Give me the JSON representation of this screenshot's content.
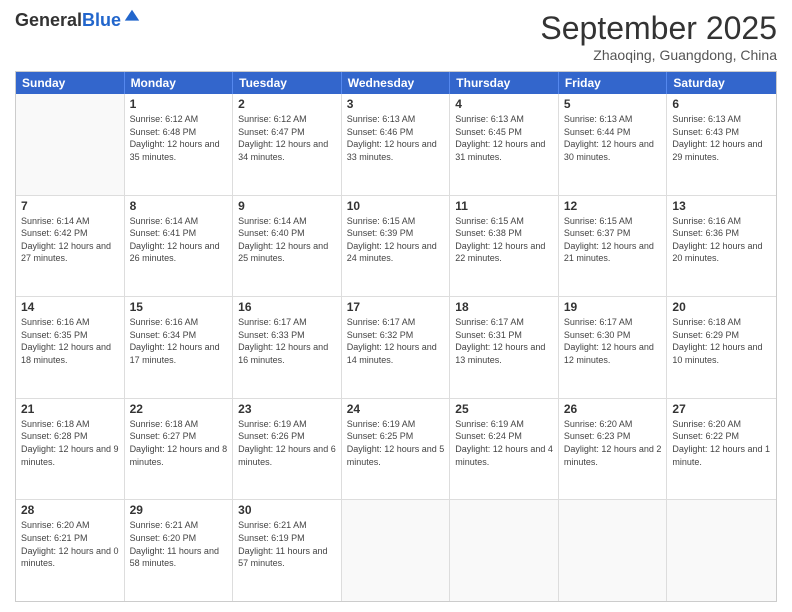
{
  "header": {
    "logo_general": "General",
    "logo_blue": "Blue",
    "month_title": "September 2025",
    "subtitle": "Zhaoqing, Guangdong, China"
  },
  "days_of_week": [
    "Sunday",
    "Monday",
    "Tuesday",
    "Wednesday",
    "Thursday",
    "Friday",
    "Saturday"
  ],
  "weeks": [
    [
      {
        "day": "",
        "sunrise": "",
        "sunset": "",
        "daylight": ""
      },
      {
        "day": "1",
        "sunrise": "Sunrise: 6:12 AM",
        "sunset": "Sunset: 6:48 PM",
        "daylight": "Daylight: 12 hours and 35 minutes."
      },
      {
        "day": "2",
        "sunrise": "Sunrise: 6:12 AM",
        "sunset": "Sunset: 6:47 PM",
        "daylight": "Daylight: 12 hours and 34 minutes."
      },
      {
        "day": "3",
        "sunrise": "Sunrise: 6:13 AM",
        "sunset": "Sunset: 6:46 PM",
        "daylight": "Daylight: 12 hours and 33 minutes."
      },
      {
        "day": "4",
        "sunrise": "Sunrise: 6:13 AM",
        "sunset": "Sunset: 6:45 PM",
        "daylight": "Daylight: 12 hours and 31 minutes."
      },
      {
        "day": "5",
        "sunrise": "Sunrise: 6:13 AM",
        "sunset": "Sunset: 6:44 PM",
        "daylight": "Daylight: 12 hours and 30 minutes."
      },
      {
        "day": "6",
        "sunrise": "Sunrise: 6:13 AM",
        "sunset": "Sunset: 6:43 PM",
        "daylight": "Daylight: 12 hours and 29 minutes."
      }
    ],
    [
      {
        "day": "7",
        "sunrise": "Sunrise: 6:14 AM",
        "sunset": "Sunset: 6:42 PM",
        "daylight": "Daylight: 12 hours and 27 minutes."
      },
      {
        "day": "8",
        "sunrise": "Sunrise: 6:14 AM",
        "sunset": "Sunset: 6:41 PM",
        "daylight": "Daylight: 12 hours and 26 minutes."
      },
      {
        "day": "9",
        "sunrise": "Sunrise: 6:14 AM",
        "sunset": "Sunset: 6:40 PM",
        "daylight": "Daylight: 12 hours and 25 minutes."
      },
      {
        "day": "10",
        "sunrise": "Sunrise: 6:15 AM",
        "sunset": "Sunset: 6:39 PM",
        "daylight": "Daylight: 12 hours and 24 minutes."
      },
      {
        "day": "11",
        "sunrise": "Sunrise: 6:15 AM",
        "sunset": "Sunset: 6:38 PM",
        "daylight": "Daylight: 12 hours and 22 minutes."
      },
      {
        "day": "12",
        "sunrise": "Sunrise: 6:15 AM",
        "sunset": "Sunset: 6:37 PM",
        "daylight": "Daylight: 12 hours and 21 minutes."
      },
      {
        "day": "13",
        "sunrise": "Sunrise: 6:16 AM",
        "sunset": "Sunset: 6:36 PM",
        "daylight": "Daylight: 12 hours and 20 minutes."
      }
    ],
    [
      {
        "day": "14",
        "sunrise": "Sunrise: 6:16 AM",
        "sunset": "Sunset: 6:35 PM",
        "daylight": "Daylight: 12 hours and 18 minutes."
      },
      {
        "day": "15",
        "sunrise": "Sunrise: 6:16 AM",
        "sunset": "Sunset: 6:34 PM",
        "daylight": "Daylight: 12 hours and 17 minutes."
      },
      {
        "day": "16",
        "sunrise": "Sunrise: 6:17 AM",
        "sunset": "Sunset: 6:33 PM",
        "daylight": "Daylight: 12 hours and 16 minutes."
      },
      {
        "day": "17",
        "sunrise": "Sunrise: 6:17 AM",
        "sunset": "Sunset: 6:32 PM",
        "daylight": "Daylight: 12 hours and 14 minutes."
      },
      {
        "day": "18",
        "sunrise": "Sunrise: 6:17 AM",
        "sunset": "Sunset: 6:31 PM",
        "daylight": "Daylight: 12 hours and 13 minutes."
      },
      {
        "day": "19",
        "sunrise": "Sunrise: 6:17 AM",
        "sunset": "Sunset: 6:30 PM",
        "daylight": "Daylight: 12 hours and 12 minutes."
      },
      {
        "day": "20",
        "sunrise": "Sunrise: 6:18 AM",
        "sunset": "Sunset: 6:29 PM",
        "daylight": "Daylight: 12 hours and 10 minutes."
      }
    ],
    [
      {
        "day": "21",
        "sunrise": "Sunrise: 6:18 AM",
        "sunset": "Sunset: 6:28 PM",
        "daylight": "Daylight: 12 hours and 9 minutes."
      },
      {
        "day": "22",
        "sunrise": "Sunrise: 6:18 AM",
        "sunset": "Sunset: 6:27 PM",
        "daylight": "Daylight: 12 hours and 8 minutes."
      },
      {
        "day": "23",
        "sunrise": "Sunrise: 6:19 AM",
        "sunset": "Sunset: 6:26 PM",
        "daylight": "Daylight: 12 hours and 6 minutes."
      },
      {
        "day": "24",
        "sunrise": "Sunrise: 6:19 AM",
        "sunset": "Sunset: 6:25 PM",
        "daylight": "Daylight: 12 hours and 5 minutes."
      },
      {
        "day": "25",
        "sunrise": "Sunrise: 6:19 AM",
        "sunset": "Sunset: 6:24 PM",
        "daylight": "Daylight: 12 hours and 4 minutes."
      },
      {
        "day": "26",
        "sunrise": "Sunrise: 6:20 AM",
        "sunset": "Sunset: 6:23 PM",
        "daylight": "Daylight: 12 hours and 2 minutes."
      },
      {
        "day": "27",
        "sunrise": "Sunrise: 6:20 AM",
        "sunset": "Sunset: 6:22 PM",
        "daylight": "Daylight: 12 hours and 1 minute."
      }
    ],
    [
      {
        "day": "28",
        "sunrise": "Sunrise: 6:20 AM",
        "sunset": "Sunset: 6:21 PM",
        "daylight": "Daylight: 12 hours and 0 minutes."
      },
      {
        "day": "29",
        "sunrise": "Sunrise: 6:21 AM",
        "sunset": "Sunset: 6:20 PM",
        "daylight": "Daylight: 11 hours and 58 minutes."
      },
      {
        "day": "30",
        "sunrise": "Sunrise: 6:21 AM",
        "sunset": "Sunset: 6:19 PM",
        "daylight": "Daylight: 11 hours and 57 minutes."
      },
      {
        "day": "",
        "sunrise": "",
        "sunset": "",
        "daylight": ""
      },
      {
        "day": "",
        "sunrise": "",
        "sunset": "",
        "daylight": ""
      },
      {
        "day": "",
        "sunrise": "",
        "sunset": "",
        "daylight": ""
      },
      {
        "day": "",
        "sunrise": "",
        "sunset": "",
        "daylight": ""
      }
    ]
  ]
}
